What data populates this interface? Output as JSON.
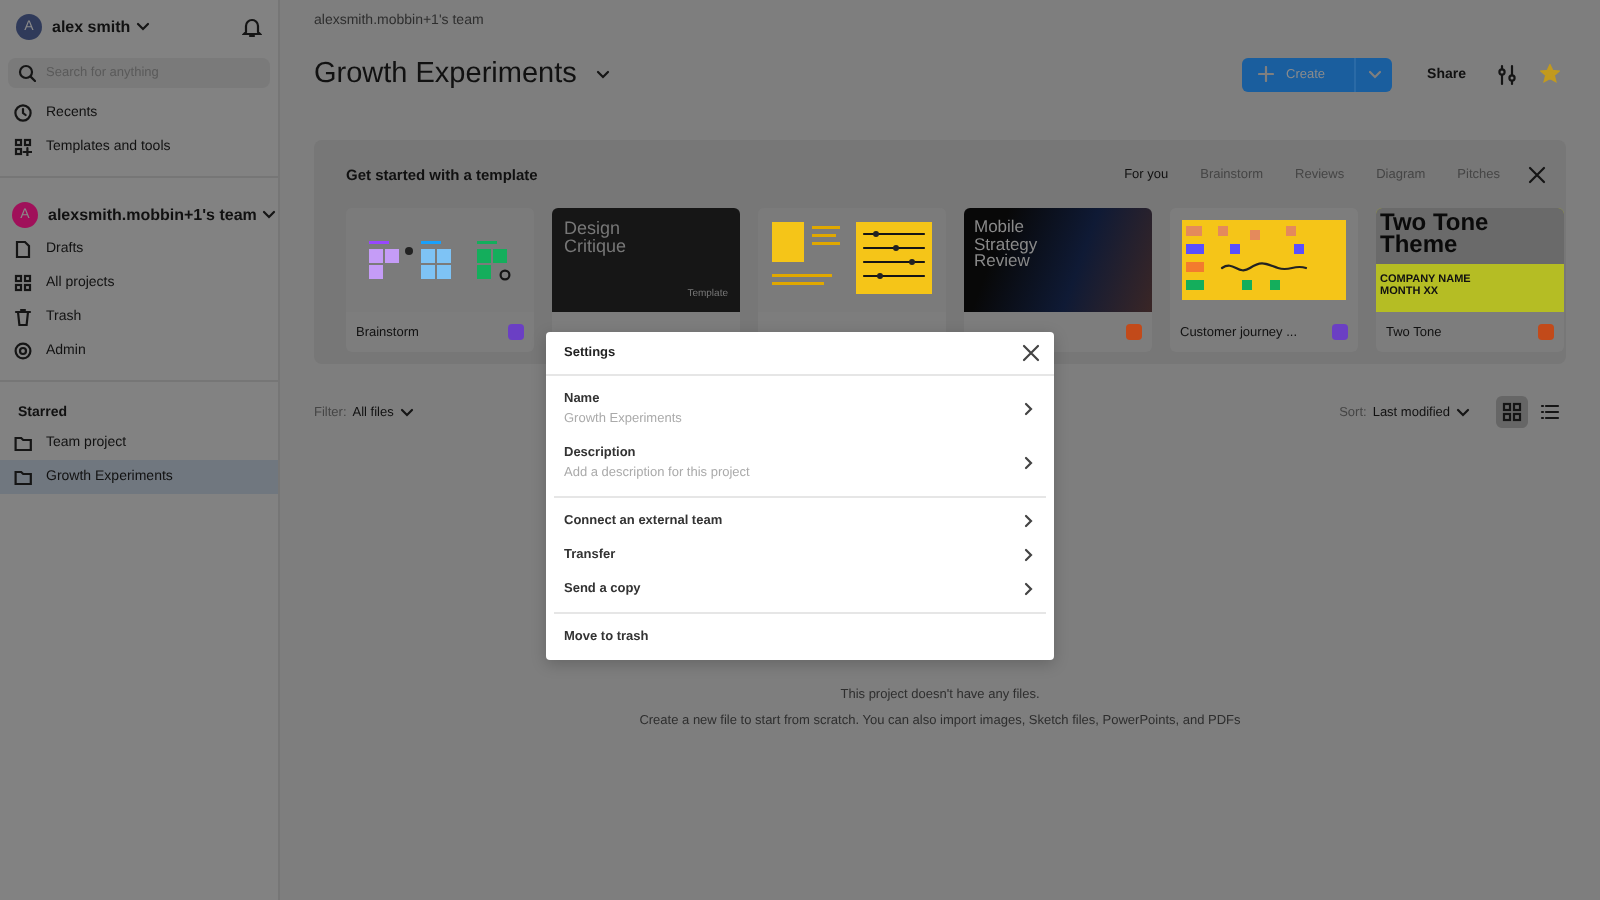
{
  "sidebar": {
    "user": {
      "initial": "A",
      "name": "alex smith"
    },
    "search": {
      "placeholder": "Search for anything"
    },
    "nav": [
      {
        "label": "Recents",
        "selected": false
      },
      {
        "label": "Templates and tools",
        "selected": false
      }
    ],
    "team": {
      "initial": "A",
      "name": "alexsmith.mobbin+1's team"
    },
    "team_nav": [
      {
        "label": "Drafts",
        "selected": false
      },
      {
        "label": "All projects",
        "selected": false
      },
      {
        "label": "Trash",
        "selected": false
      },
      {
        "label": "Admin",
        "selected": false
      }
    ],
    "starred_heading": "Starred",
    "starred": [
      {
        "label": "Team project",
        "selected": false
      },
      {
        "label": "Growth Experiments",
        "selected": true
      }
    ]
  },
  "header": {
    "breadcrumb": "alexsmith.mobbin+1's team",
    "title": "Growth Experiments",
    "create_label": "Create",
    "share_label": "Share",
    "favorite": true
  },
  "templates": {
    "title": "Get started with a template",
    "tabs": [
      {
        "label": "For you",
        "selected": true
      },
      {
        "label": "Brainstorm",
        "selected": false
      },
      {
        "label": "Reviews",
        "selected": false
      },
      {
        "label": "Diagram",
        "selected": false
      },
      {
        "label": "Pitches",
        "selected": false
      }
    ],
    "cards": [
      {
        "kind": "stickies",
        "label": "Brainstorm",
        "color": "#6b3fc4"
      },
      {
        "kind": "dark",
        "heading": "Design Critique",
        "caption": "Template"
      },
      {
        "kind": "board"
      },
      {
        "kind": "gradient",
        "heading": "Mobile Strategy Review",
        "color": "#c24a1a"
      },
      {
        "kind": "journey",
        "label": "Customer journey ...",
        "color": "#6b3fc4"
      },
      {
        "kind": "twotone",
        "heading": "Two Tone Theme",
        "subheading": "COMPANY NAME MONTH XX",
        "label": "Two Tone",
        "color": "#c24a1a"
      }
    ]
  },
  "toolbar": {
    "filter_label": "Filter:",
    "filter_value": "All files",
    "sort_label": "Sort:",
    "sort_value": "Last modified",
    "views": [
      {
        "kind": "grid",
        "selected": true
      },
      {
        "kind": "list",
        "selected": false
      }
    ]
  },
  "empty": {
    "title": "This project doesn't have any files.",
    "text": "Create a new file to start from scratch. You can also import images, Sketch files, PowerPoints, and PDFs"
  },
  "dialog": {
    "title": "Settings",
    "groups": [
      [
        {
          "label": "Name",
          "value": "Growth Experiments",
          "chevron": true
        },
        {
          "label": "Description",
          "value": "Add a description for this project",
          "chevron": true
        }
      ],
      [
        {
          "label": "Connect an external team",
          "chevron": true
        },
        {
          "label": "Transfer",
          "chevron": true
        },
        {
          "label": "Send a copy",
          "chevron": true
        }
      ],
      [
        {
          "label": "Move to trash",
          "chevron": false
        }
      ]
    ]
  }
}
